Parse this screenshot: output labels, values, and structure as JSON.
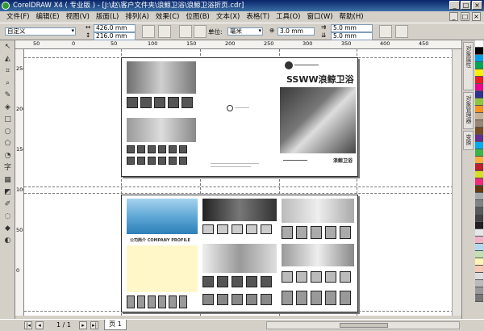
{
  "title": "CorelDRAW X4 ( 专业版 ) - [J:\\赵\\客户文件夹\\浪鲸卫浴\\浪鲸卫浴折页.cdr]",
  "window_buttons": [
    "_",
    "□",
    "×"
  ],
  "menu": [
    "文件(F)",
    "编辑(E)",
    "视图(V)",
    "版面(L)",
    "排列(A)",
    "效果(C)",
    "位图(B)",
    "文本(X)",
    "表格(T)",
    "工具(O)",
    "窗口(W)",
    "帮助(H)"
  ],
  "menu_tail": [
    "_",
    "□",
    "×"
  ],
  "toolbar": {
    "preset": "自定义",
    "width": "426.0 mm",
    "height": "216.0 mm",
    "unit_label": "单位:",
    "unit_value": "毫米",
    "nudge": "3.0 mm",
    "dup_x": "5.0 mm",
    "dup_y": "5.0 mm"
  },
  "ruler_h": [
    "50",
    "0",
    "50",
    "100",
    "150",
    "200",
    "250",
    "300",
    "350",
    "400",
    "450"
  ],
  "ruler_v": [
    "250",
    "200",
    "150",
    "100",
    "50",
    "0"
  ],
  "brand": {
    "logo": "SSWW浪鲸卫浴",
    "small": "浪鲸卫浴",
    "profile": "公司简介 COMPANY PROFILE"
  },
  "dockers": [
    "对象属性",
    "对象管理器",
    "变换"
  ],
  "status": {
    "page_count": "1 / 1",
    "page_tab": "页 1"
  },
  "palette_colors": [
    "#ffffff",
    "#000000",
    "#00a0e9",
    "#00a651",
    "#fff200",
    "#ed1c24",
    "#ec008c",
    "#2e3192",
    "#8dc63f",
    "#f7941d",
    "#c7b299",
    "#998675",
    "#754c24",
    "#662d91",
    "#00aeef",
    "#39b54a",
    "#fbb040",
    "#be1e2d",
    "#d7df23",
    "#ee2a7b",
    "#603913",
    "#a7a9ac",
    "#808285",
    "#58595b",
    "#414042",
    "#231f20",
    "#e6e7e8",
    "#f2b3c8",
    "#b3d9f2",
    "#c2e0b4",
    "#fdf6b3",
    "#f9c9b3",
    "#dddddd",
    "#bbbbbb",
    "#999999",
    "#777777"
  ]
}
